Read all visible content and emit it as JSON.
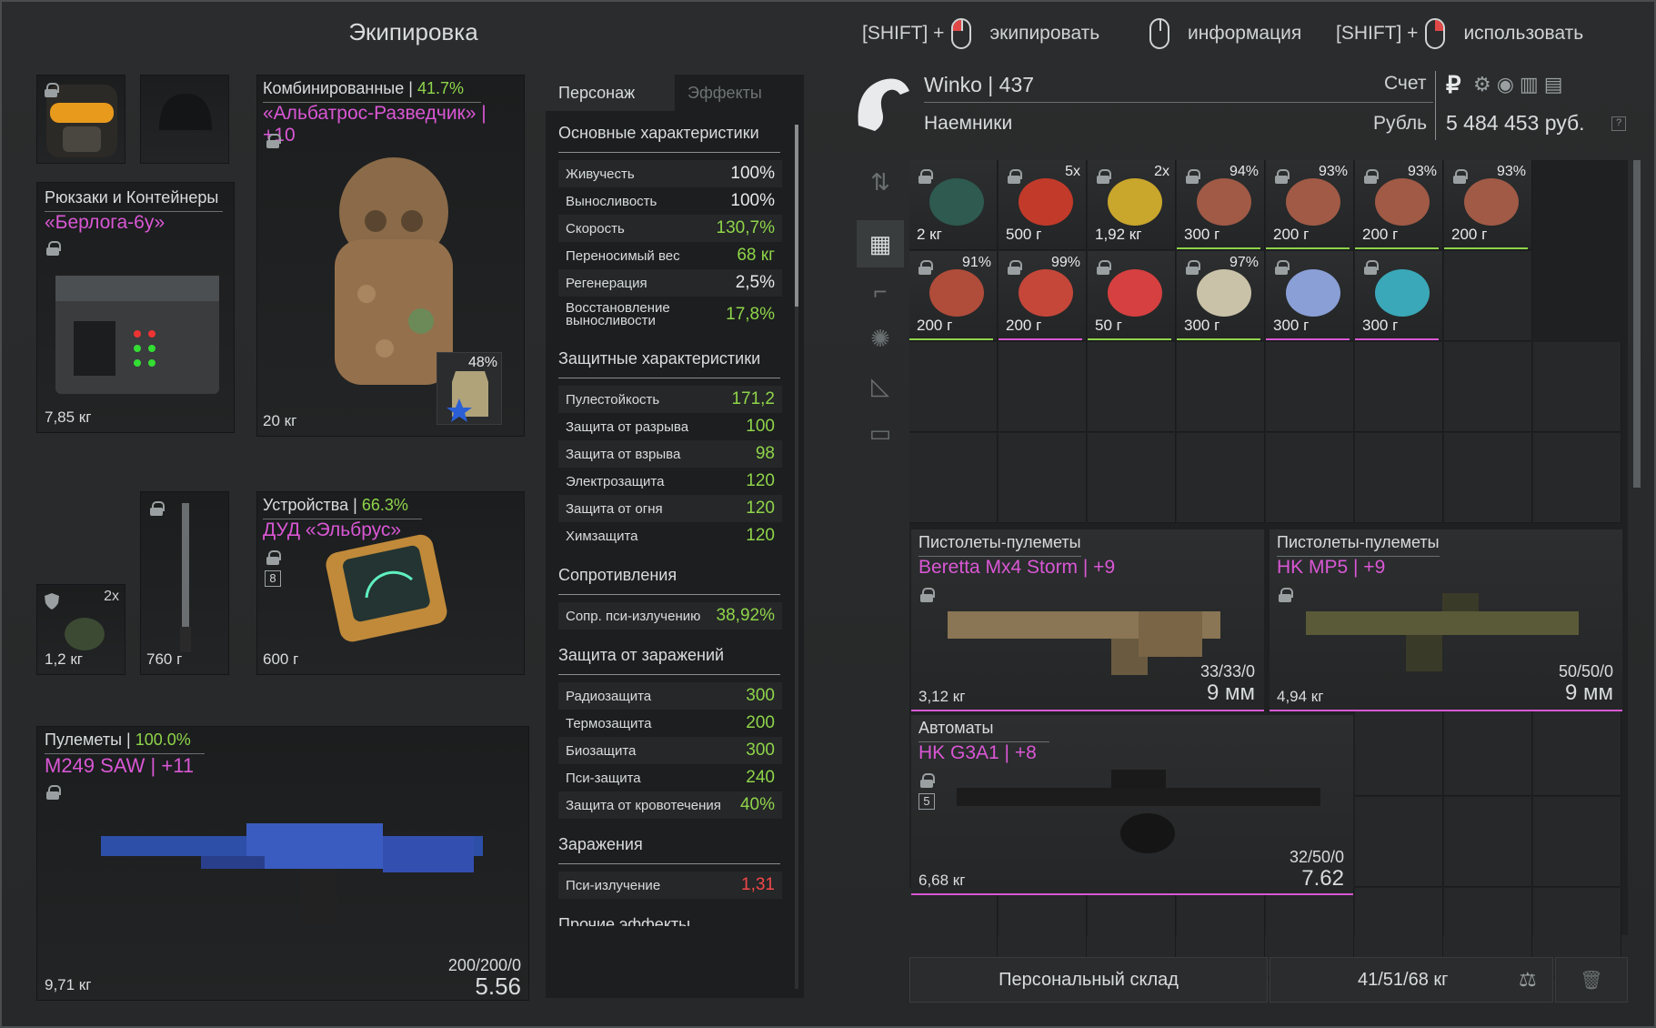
{
  "equipment": {
    "title": "Экипировка",
    "backpack": {
      "category": "Рюкзаки и Контейнеры",
      "name": "«Берлога-6у»",
      "weight": "7,85 кг"
    },
    "armor": {
      "category": "Комбинированные",
      "durability": "41.7%",
      "name": "«Альбатрос-Разведчик» | +10",
      "weight": "20 кг",
      "plate_pct": "48%"
    },
    "grenade": {
      "count": "2x",
      "weight": "1,2 кг"
    },
    "melee": {
      "weight": "760 г"
    },
    "device": {
      "category": "Устройства",
      "durability": "66.3%",
      "name": "ДУД «Эльбрус»",
      "slots": "8",
      "weight": "600 г"
    },
    "primary": {
      "category": "Пулеметы",
      "durability": "100.0%",
      "name": "M249 SAW | +11",
      "ammo": "200/200/0",
      "caliber": "5.56",
      "weight": "9,71 кг"
    }
  },
  "hints": {
    "equip_mod": "[SHIFT] +",
    "equip": "экипировать",
    "info": "информация",
    "use_mod": "[SHIFT] +",
    "use": "использовать"
  },
  "stats": {
    "tabs": [
      "Персонаж",
      "Эффекты"
    ],
    "main_title": "Основные характеристики",
    "main": [
      {
        "label": "Живучесть",
        "value": "100%",
        "color": "white"
      },
      {
        "label": "Выносливость",
        "value": "100%",
        "color": "white"
      },
      {
        "label": "Скорость",
        "value": "130,7%",
        "color": "green"
      },
      {
        "label": "Переносимый вес",
        "value": "68 кг",
        "color": "green"
      },
      {
        "label": "Регенерация",
        "value": "2,5%",
        "color": "white"
      },
      {
        "label": "Восстановление выносливости",
        "value": "17,8%",
        "color": "green"
      }
    ],
    "protect_title": "Защитные характеристики",
    "protect": [
      {
        "label": "Пулестойкость",
        "value": "171,2"
      },
      {
        "label": "Защита от разрыва",
        "value": "100"
      },
      {
        "label": "Защита от взрыва",
        "value": "98"
      },
      {
        "label": "Электрозащита",
        "value": "120"
      },
      {
        "label": "Защита от огня",
        "value": "120"
      },
      {
        "label": "Химзащита",
        "value": "120"
      }
    ],
    "resist_title": "Сопротивления",
    "resist": [
      {
        "label": "Сопр. пси-излучению",
        "value": "38,92%"
      }
    ],
    "infect_title": "Защита от заражений",
    "infect": [
      {
        "label": "Радиозащита",
        "value": "300"
      },
      {
        "label": "Термозащита",
        "value": "200"
      },
      {
        "label": "Биозащита",
        "value": "300"
      },
      {
        "label": "Пси-защита",
        "value": "240"
      },
      {
        "label": "Защита от кровотечения",
        "value": "40%"
      }
    ],
    "contam_title": "Заражения",
    "contam": [
      {
        "label": "Пси-излучение",
        "value": "1,31"
      }
    ],
    "cut_title": "Прочие эффекты"
  },
  "player": {
    "name": "Winko | 437",
    "faction": "Наемники",
    "account_label": "Счет",
    "currency_label": "Рубль",
    "money": "5 484 453 руб.",
    "help": "?"
  },
  "inventory": {
    "row1": [
      {
        "weight": "2 кг",
        "pct": "",
        "line": "none"
      },
      {
        "weight": "500 г",
        "pct": "5x",
        "line": "none"
      },
      {
        "weight": "1,92 кг",
        "pct": "2x",
        "line": "none"
      },
      {
        "weight": "300 г",
        "pct": "94%",
        "line": "green"
      },
      {
        "weight": "200 г",
        "pct": "93%",
        "line": "green"
      },
      {
        "weight": "200 г",
        "pct": "93%",
        "line": "green"
      },
      {
        "weight": "200 г",
        "pct": "93%",
        "line": "green"
      }
    ],
    "row2": [
      {
        "weight": "200 г",
        "pct": "91%",
        "line": "green"
      },
      {
        "weight": "200 г",
        "pct": "99%",
        "line": "pink"
      },
      {
        "weight": "50 г",
        "pct": "",
        "line": "green"
      },
      {
        "weight": "300 г",
        "pct": "97%",
        "line": "green"
      },
      {
        "weight": "300 г",
        "pct": "",
        "line": "pink"
      },
      {
        "weight": "300 г",
        "pct": "",
        "line": "pink"
      }
    ],
    "weapons": [
      {
        "category": "Пистолеты-пулеметы",
        "name": "Beretta Mx4 Storm | +9",
        "ammo": "33/33/0",
        "caliber": "9 мм",
        "weight": "3,12 кг"
      },
      {
        "category": "Пистолеты-пулеметы",
        "name": "HK MP5 | +9",
        "ammo": "50/50/0",
        "caliber": "9 мм",
        "weight": "4,94 кг"
      },
      {
        "category": "Автоматы",
        "name": "HK G3A1 | +8",
        "slots": "5",
        "ammo": "32/50/0",
        "caliber": "7.62",
        "weight": "6,68 кг"
      }
    ],
    "stash_button": "Персональный склад",
    "total_weight": "41/51/68 кг"
  },
  "colors": {
    "green": "#8fd44a",
    "pink": "#d957d4",
    "red": "#f2484a"
  }
}
